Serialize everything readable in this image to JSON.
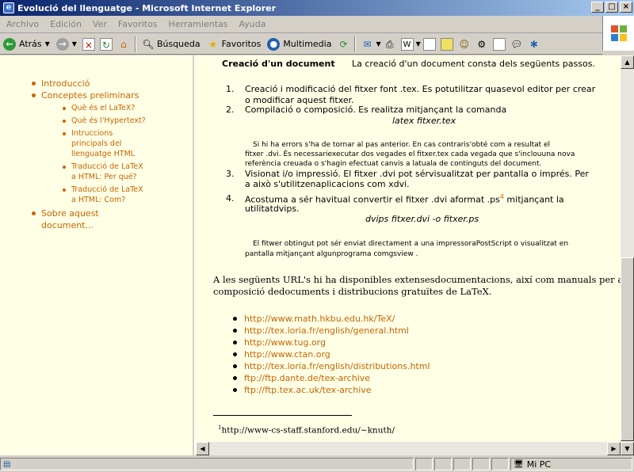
{
  "window": {
    "title": "Evolució del llenguatge - Microsoft Internet Explorer",
    "minimize": "_",
    "maximize": "□",
    "close": "×"
  },
  "menu": [
    "Archivo",
    "Edición",
    "Ver",
    "Favoritos",
    "Herramientas",
    "Ayuda"
  ],
  "toolbar": {
    "back": "Atrás",
    "search": "Búsqueda",
    "favorites": "Favoritos",
    "media": "Multimedia"
  },
  "nav": {
    "items": [
      {
        "label": "Introducció"
      },
      {
        "label": "Conceptes preliminars"
      },
      {
        "label": "Sobre aquest"
      },
      {
        "label": "document..."
      }
    ],
    "subitems": [
      "Què és el LaTeX?",
      "Què és l'Hypertext?",
      "Intruccions",
      "principals del",
      "llenguatge HTML",
      "Traducció de LaTeX",
      "a HTML: Per qué?",
      "Traducció de LaTeX",
      "a HTML: Com?"
    ]
  },
  "doc": {
    "heading": "Creació d'un document",
    "intro": "La creació d'un document consta dels següents passos.",
    "n1": "1.",
    "n2": "2.",
    "n3": "3.",
    "n4": "4.",
    "s1a": "Creació i modificació del fitxer font .tex. Es potutilitzar quasevol editor per crear",
    "s1b": "o modificar aquest fitxer.",
    "s2a": "Compilació o composició. Es realitza mitjançant la comanda",
    "cmd1": "latex fitxer.tex",
    "note1a": "Si hi ha errors s'ha de tornar al pas anterior. En cas contraris'obté com a resultat el",
    "note1b": "fitxer .dvi. És necessariexecutar dos vegades el fitxer.tex cada vegada que s'inclouuna nova",
    "note1c": "referència creuada o s'hagin efectuat canvis a latuala de continguts del document.",
    "s3a": "Visionat i/o impressió. El fitxer .dvi pot sérvisualitzat per pantalla o imprés. Per",
    "s3b": "a això s'utilitzenaplicacions com xdvi.",
    "s4a": "Acostuma a sér havitual convertir el fitxer .dvi aformat .ps",
    "sup4": "4",
    "s4a2": " mitjançant la",
    "s4b": "utilitatdvips.",
    "cmd2": "dvips fitxer.dvi -o fitxer.ps",
    "note2a": "El fitwer obtingut pot sér enviat directament a una impressoraPostScript o visualitzat en",
    "note2b": "pantalla mitjançant algunprograma comgsview .",
    "para1": "A les següents URL's hi ha disponibles extensesdocumentacions, així com manuals per a la",
    "para2": "composició dedocuments i distribucions gratuïtes de LaTeX.",
    "urls": [
      "http://www.math.hkbu.edu.hk/TeX/",
      "http://tex.loria.fr/english/general.html",
      "http://www.tug.org",
      "http://www.ctan.org",
      "http://tex.loria.fr/english/distributions.html",
      "ftp://ftp.dante.de/tex-archive",
      "ftp://ftp.tex.ac.uk/tex-archive"
    ],
    "foot1_sup": "1",
    "foot1": "http://www-cs-staff.stanford.edu/~knuth/"
  },
  "status": {
    "zone": "Mi PC"
  }
}
